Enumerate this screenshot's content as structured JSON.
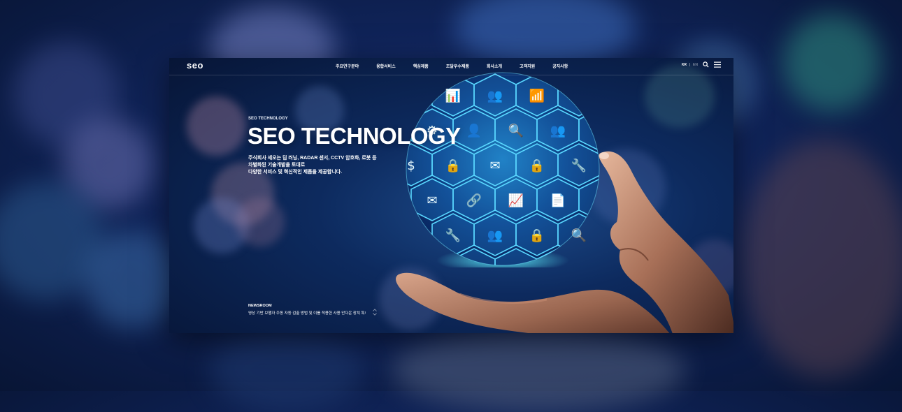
{
  "header": {
    "logo": "seo",
    "nav": [
      "주요연구분야",
      "융합서비스",
      "핵심제품",
      "조달우수제품",
      "회사소개",
      "고객지원",
      "공지사항"
    ],
    "lang_active": "KR",
    "lang_other": "EN",
    "search_icon": "search-icon",
    "menu_icon": "hamburger-menu-icon"
  },
  "hero": {
    "eyebrow": "SEO TECHNOLOGY",
    "title": "SEO TECHNOLOGY",
    "desc_line1": "주식회사 세오는 딥 러닝, RADAR 센서, CCTV 암호화, 로봇 등",
    "desc_line2": "차별화된 기술개발을 토대로",
    "desc_line3": "다양한 서비스 및 혁신적인 제품을 제공합니다."
  },
  "newsroom": {
    "label": "NEWSROOM",
    "headline": "영상 기반 보행자 주동 자동 검출 방법 및 이를 적용한 사용 안다운 장치 특허출1..."
  },
  "colors": {
    "background": "#10245a",
    "accent": "#36d6f0",
    "text": "#ffffff"
  }
}
